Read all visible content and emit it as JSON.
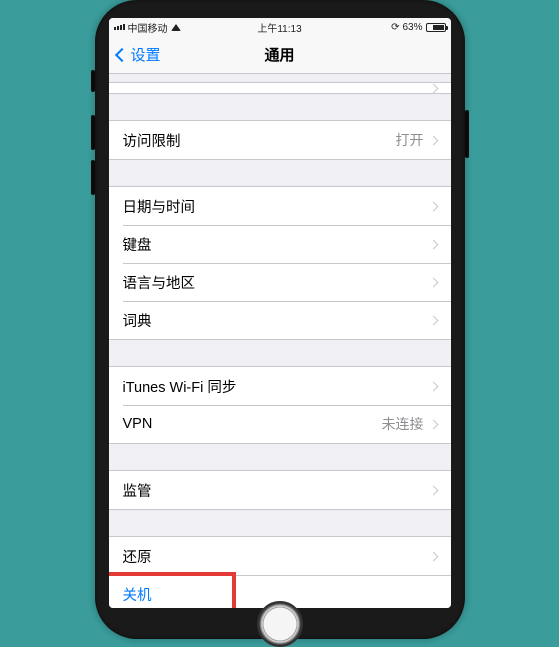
{
  "status": {
    "carrier": "中国移动",
    "time": "上午11:13",
    "battery_pct": "63%"
  },
  "nav": {
    "back_label": "设置",
    "title": "通用"
  },
  "rows": {
    "restrictions": {
      "label": "访问限制",
      "value": "打开"
    },
    "datetime": {
      "label": "日期与时间"
    },
    "keyboard": {
      "label": "键盘"
    },
    "language": {
      "label": "语言与地区"
    },
    "dictionary": {
      "label": "词典"
    },
    "itunes_wifi": {
      "label": "iTunes Wi-Fi 同步"
    },
    "vpn": {
      "label": "VPN",
      "value": "未连接"
    },
    "regulatory": {
      "label": "监管"
    },
    "reset": {
      "label": "还原"
    },
    "shutdown": {
      "label": "关机"
    }
  }
}
